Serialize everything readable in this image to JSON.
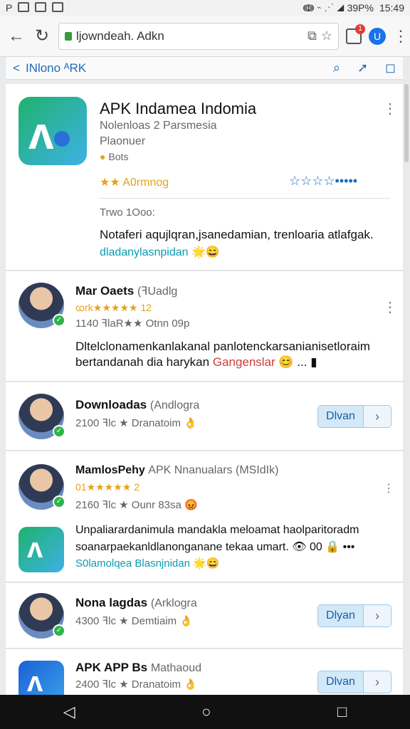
{
  "status_bar": {
    "left_icons": [
      "P",
      "▣",
      "▣",
      "▣"
    ],
    "right_text": "ↈ  ⌁  ⋰  ◢  39P%",
    "time": "15:49"
  },
  "browser": {
    "back": "←",
    "reload": "↻",
    "url": "ljowndeah. Adkn",
    "tab_count": "1",
    "profile": "U"
  },
  "app_header": {
    "back": "<",
    "title": "INlono ᴬRK"
  },
  "hero": {
    "title": "APK Indamea Indomia",
    "subtitle": "Nolenloas 2 Parsmesia",
    "developer": "Plaonuer",
    "badge": "Bots",
    "rating_label": "★★ A0rmnog",
    "stars_blue": "☆☆☆☆•••••",
    "meta": "Trwo 1Ooo:",
    "description": "Notaferi aqujlqran,jsanedamian, trenloaria atlafgak.",
    "tagline": "dladanylasnpidan 🌟😄"
  },
  "items": [
    {
      "name": "Mar Oaets",
      "tag": "(ꟻUadlg",
      "rating": "ꭃrk★★★★★ 12",
      "stats": "1140 ꟻlaR★★ Otnn 09p",
      "text1": "Dltelclonamenkanlakanal panlotenckarsanianisetloraim",
      "text2a": "bertandanah dia harykan ",
      "text2b": "Gangenslar",
      "text2c": " 😊 ... ▮"
    }
  ],
  "downloads": [
    {
      "name": "Downloadas",
      "tag": "(Andlogra",
      "stats": "2100 ꟻlc ★ Dranatoim 👌",
      "btn": "Dlvan"
    },
    {
      "name": "Nona lagdas",
      "tag": "(Arklogra",
      "stats": "4300 ꟻlc ★ Demtiaim 👌",
      "btn": "Dlyan"
    },
    {
      "name": "APK APP Bs",
      "tag": "Mathaoud",
      "stats": "2400 ꟻlc ★ Dranatoim 👌",
      "btn": "Dlvan"
    }
  ],
  "item3": {
    "name": "MamlosPehy",
    "tag": "APK Nnanualars (MSIdIk)",
    "rating": "01★★★★★ 2",
    "stats": "2160 ꟻlc ★ Ounr 83sa 😡",
    "text1": "Unpaliarardanimula mandakla meloamat haolparitoradm",
    "text2": "soanarpaekanldlanonganane tekaa umart. 👁 00 🔒 •••",
    "tagline": "S0lamolqea Blasnjnidan 🌟😄"
  },
  "nav": {
    "back": "◁",
    "home": "○",
    "recent": "□"
  }
}
